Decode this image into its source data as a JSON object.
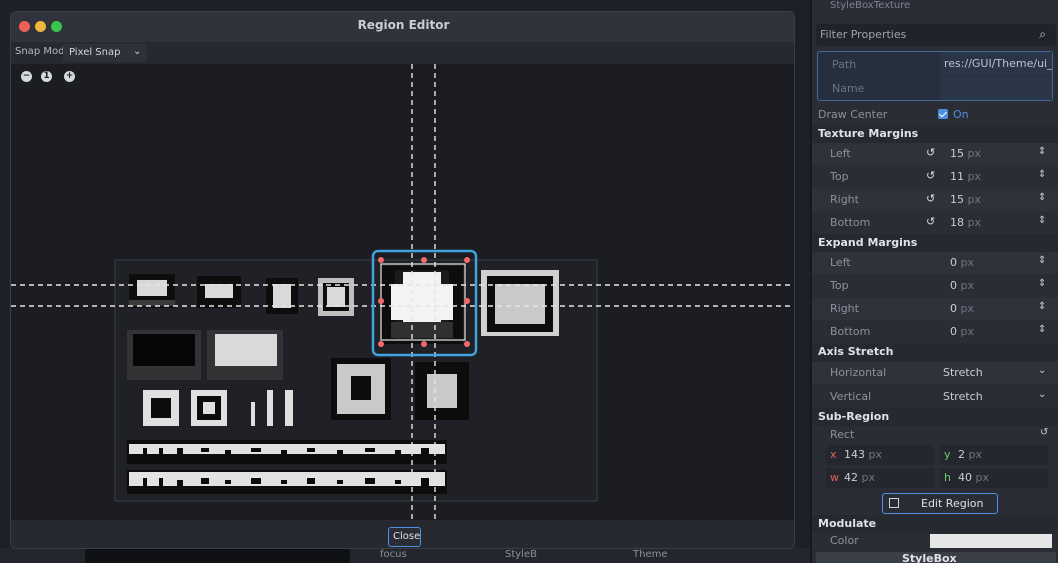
{
  "dialog": {
    "title": "Region Editor",
    "traffic_lights": {
      "close": "#ee5f57",
      "minimize": "#f0b53c",
      "maximize": "#38c44e"
    },
    "snap_mode_label": "Snap Mode:",
    "snap_mode_value": "Pixel Snap",
    "zoom_out_icon": "minus-icon",
    "zoom_reset_label": "1",
    "zoom_in_icon": "plus-icon",
    "close_label": "Close"
  },
  "inspector": {
    "top_label": "StyleBoxTexture",
    "filter_placeholder": "Filter Properties",
    "path_label": "Path",
    "path_value": "res://GUI/Theme/ui_e",
    "name_label": "Name",
    "draw_center_label": "Draw Center",
    "draw_center_value": "On",
    "texture_margins": {
      "title": "Texture Margins",
      "left_label": "Left",
      "left_value": "15",
      "top_label": "Top",
      "top_value": "11",
      "right_label": "Right",
      "right_value": "15",
      "bottom_label": "Bottom",
      "bottom_value": "18"
    },
    "expand_margins": {
      "title": "Expand Margins",
      "left_label": "Left",
      "left_value": "0",
      "top_label": "Top",
      "top_value": "0",
      "right_label": "Right",
      "right_value": "0",
      "bottom_label": "Bottom",
      "bottom_value": "0"
    },
    "unit": "px",
    "axis_stretch": {
      "title": "Axis Stretch",
      "horizontal_label": "Horizontal",
      "horizontal_value": "Stretch",
      "vertical_label": "Vertical",
      "vertical_value": "Stretch"
    },
    "sub_region": {
      "title": "Sub-Region",
      "rect_label": "Rect",
      "x_key": "x",
      "x_value": "143",
      "y_key": "y",
      "y_value": "2",
      "w_key": "w",
      "w_value": "42",
      "h_key": "h",
      "h_value": "40",
      "edit_button": "Edit Region"
    },
    "modulate": {
      "title": "Modulate",
      "color_label": "Color",
      "color_value": "#e6e6e6"
    },
    "stylebox_label": "StyleBox"
  },
  "background": {
    "focus_label": "focus",
    "styleb_label": "StyleB",
    "theme_label": "Theme"
  }
}
